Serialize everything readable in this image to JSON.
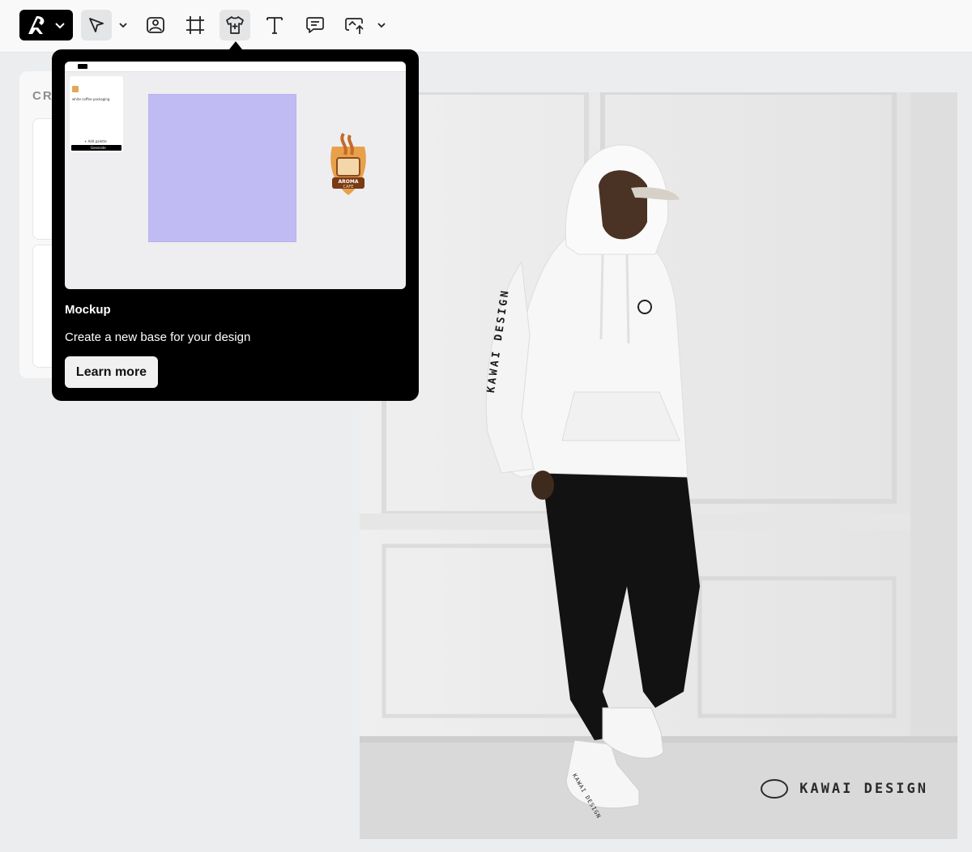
{
  "toolbar": {
    "tools": [
      {
        "name": "select",
        "icon": "pointer-icon",
        "active": true
      },
      {
        "name": "image",
        "icon": "image-icon"
      },
      {
        "name": "frame",
        "icon": "frame-icon"
      },
      {
        "name": "mockup",
        "icon": "tshirt-plus-icon",
        "active": true
      },
      {
        "name": "text",
        "icon": "text-icon"
      },
      {
        "name": "comment",
        "icon": "comment-icon"
      },
      {
        "name": "upload",
        "icon": "cloud-upload-icon"
      }
    ]
  },
  "panel": {
    "title": "CR"
  },
  "popover": {
    "title": "Mockup",
    "description": "Create a new base for your design",
    "button_label": "Learn more",
    "preview": {
      "prompt_text": "white coffee packaging",
      "add_palette": "+ Add palette",
      "generate": "Generate",
      "logo_line1": "AROMA",
      "logo_line2": "CAFE"
    }
  },
  "photo": {
    "sleeve_text": "KAWAI DESIGN",
    "watermark": "KAWAI DESIGN",
    "shoe_text": "KAWAI DESIGN"
  },
  "colors": {
    "accent_purple": "#c0bcf3",
    "popover_bg": "#000000",
    "canvas_bg": "#ecedef"
  }
}
